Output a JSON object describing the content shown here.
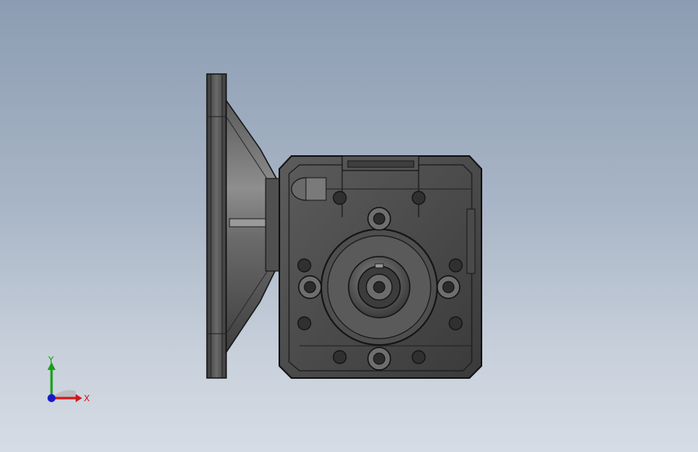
{
  "viewport": {
    "background_top": "#8c9cb2",
    "background_bottom": "#d6dce5"
  },
  "model": {
    "description_icon": "worm-gearbox-icon",
    "body_color": "#4a4a4a",
    "edge_color": "#1a1a1a",
    "highlight_color": "#8a8a8a"
  },
  "triad": {
    "x_label": "X",
    "y_label": "Y",
    "x_color": "#d01818",
    "y_color": "#18a018",
    "z_color": "#1818c8"
  }
}
